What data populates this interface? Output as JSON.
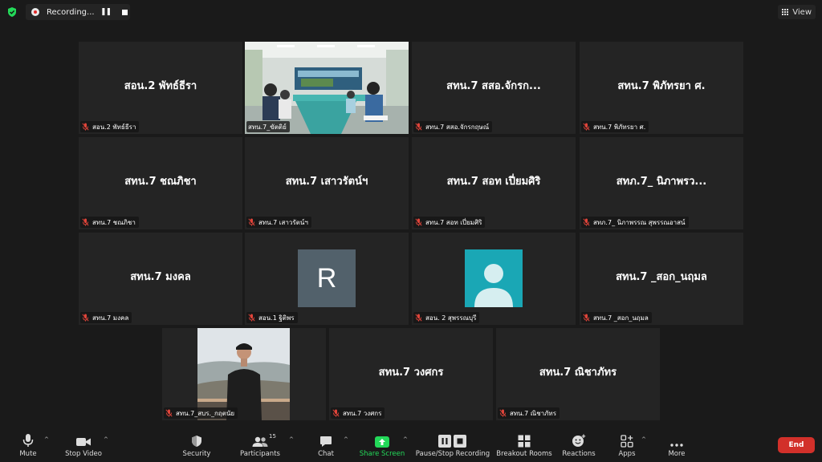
{
  "recording": {
    "label": "Recording..."
  },
  "view": {
    "label": "View"
  },
  "tiles": [
    {
      "name": "สอน.2 พัทธ์ธีรา",
      "label": "สอน.2 พัทธ์ธีรา"
    },
    {
      "name": "",
      "label": "สทน.7_ขัตติย์"
    },
    {
      "name": "สทน.7 สสอ.จักรก...",
      "label": "สทน.7 สสอ.จักรกฤษณ์"
    },
    {
      "name": "สทน.7 พิภัทรยา ศ.",
      "label": "สทน.7 พิภัทรยา ศ."
    },
    {
      "name": "สทน.7 ชณภิชา",
      "label": "สทน.7 ชณภิชา"
    },
    {
      "name": "สทน.7 เสาวรัตน์ฯ",
      "label": "สทน.7 เสาวรัตน์ฯ"
    },
    {
      "name": "สทน.7 สอท เปี่ยมศิริ",
      "label": "สทน.7 สอท เปี่ยมศิริ"
    },
    {
      "name": "สทภ.7_ นิภาพรว...",
      "label": "สทภ.7_ นิภาพรรณ สุพรรณอาสน์"
    },
    {
      "name": "สทน.7 มงคล",
      "label": "สทน.7 มงคล"
    },
    {
      "name": "R",
      "label": "สอน.1 ฐิติพร"
    },
    {
      "name": "",
      "label": "สอน. 2 สุพรรณบุรี"
    },
    {
      "name": "สทน.7 _สอก_นฤมล",
      "label": "สทน.7 _สอก_นฤมล"
    },
    {
      "name": "",
      "label": "สทน.7_สบร._กฤตนัย"
    },
    {
      "name": "สทน.7 วงศกร",
      "label": "สทน.7 วงศกร"
    },
    {
      "name": "สทน.7 ณิชาภัทร",
      "label": "สทน.7 ณิชาภัทร"
    }
  ],
  "toolbar": {
    "mute": "Mute",
    "stop_video": "Stop Video",
    "security": "Security",
    "participants": "Participants",
    "participants_count": "15",
    "chat": "Chat",
    "share_screen": "Share Screen",
    "pause_stop_recording": "Pause/Stop Recording",
    "breakout_rooms": "Breakout Rooms",
    "reactions": "Reactions",
    "apps": "Apps",
    "more": "More",
    "end": "End"
  },
  "colors": {
    "accent_green": "#23d959",
    "end_red": "#d2302a",
    "speaker_outline": "#e6e06a",
    "mic_off_red": "#e0443a"
  }
}
